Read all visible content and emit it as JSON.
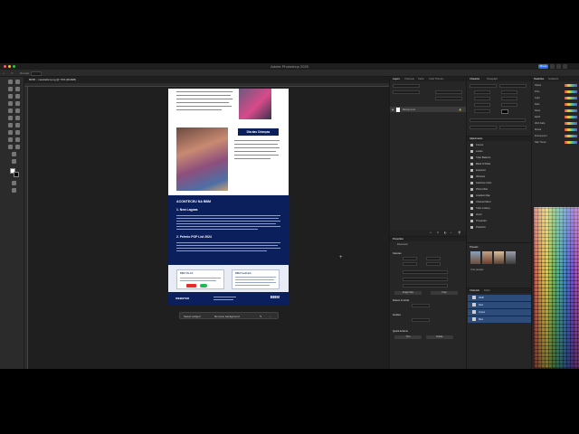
{
  "app": {
    "title": "Adobe Photoshop 2025",
    "share_label": "Share"
  },
  "options_bar": {
    "mode_label": "Normal"
  },
  "document": {
    "tab_label": "BWB – newsletter.png @ 73% (RGB/8)",
    "badge": "Dia das Crianças",
    "section_title": "ACONTECEU NA BBM",
    "heading_1": "1. New Lagoas",
    "heading_2": "2. Prêmio POP List 2024",
    "card_left_title": "BBM TALKS",
    "card_right_title": "BBM Feedback",
    "footer_logo": "WEBSTER",
    "footer_mark": "BBM"
  },
  "context_bar": {
    "select_subject": "Select subject",
    "remove_background": "Remove background"
  },
  "layers_panel": {
    "tabs": [
      "Layers",
      "Channels",
      "Paths",
      "Color Themes"
    ],
    "layer_name": "Background"
  },
  "properties_panel": {
    "title": "Properties",
    "type_label": "Document",
    "sections": [
      "Canvas",
      "Rulers & Grids",
      "Guides",
      "Quick Actions"
    ],
    "buttons": [
      "Image Size",
      "Crop",
      "Trim",
      "Rotate"
    ]
  },
  "character_panel": {
    "tabs": [
      "Character",
      "Paragraph"
    ]
  },
  "adjustments_panel": {
    "title": "Adjustments",
    "items": [
      "Curves",
      "Levels",
      "Color Balance",
      "Black & White",
      "Exposure",
      "Vibrance",
      "Selective Color",
      "Photo Filter",
      "Gradient Map",
      "Channel Mixer",
      "Color Lookup",
      "Invert",
      "Threshold",
      "Posterize"
    ]
  },
  "presets_panel": {
    "title": "Presets",
    "more_label": "Your presets"
  },
  "channels_panel": {
    "tabs": [
      "Channels",
      "Paths"
    ],
    "rows": [
      "RGB",
      "Red",
      "Green",
      "Blue"
    ]
  },
  "swatches_panel": {
    "tabs": [
      "Swatches",
      "Gradients"
    ],
    "groups": [
      "Pastel",
      "Pure",
      "Light",
      "Dark",
      "Deep",
      "Earth",
      "Web Safe",
      "Muted",
      "Fluorescent",
      "Skin Tones"
    ]
  }
}
